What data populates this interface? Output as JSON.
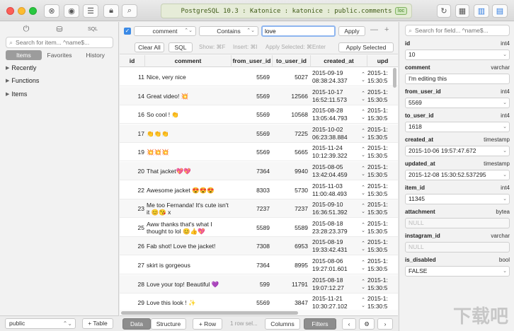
{
  "toolbar": {
    "connection": "PostgreSQL 10.3 : Katonice : katonice : public.comments",
    "loc_badge": "loc"
  },
  "sidebar": {
    "search_placeholder": "Search for item... ^name$...",
    "tabs": [
      "Items",
      "Favorites",
      "History"
    ],
    "tree": [
      "Recently",
      "Functions",
      "Items"
    ],
    "schema": "public",
    "add_table": "+ Table"
  },
  "filter": {
    "column": "comment",
    "operator": "Contains",
    "value": "love",
    "apply": "Apply",
    "clear_all": "Clear All",
    "sql": "SQL",
    "show_hint": "Show: ⌘F",
    "insert_hint": "Insert: ⌘I",
    "apply_selected_hint": "Apply Selected: ⌘Enter",
    "apply_selected": "Apply Selected"
  },
  "table": {
    "columns": [
      "id",
      "comment",
      "from_user_id",
      "to_user_id",
      "created_at",
      "upd"
    ],
    "rows": [
      {
        "id": "11",
        "comment": "Nice, very nice",
        "from": "5569",
        "to": "5027",
        "created": [
          "2015-09-19",
          "08:38:24.337"
        ],
        "upd": [
          "2015-1:",
          "15:30:5"
        ]
      },
      {
        "id": "14",
        "comment": "Great video! 💥",
        "from": "5569",
        "to": "12566",
        "created": [
          "2015-10-17",
          "16:52:11.573"
        ],
        "upd": [
          "2015-1:",
          "15:30:5"
        ]
      },
      {
        "id": "16",
        "comment": "So cool ! 👏",
        "from": "5569",
        "to": "10568",
        "created": [
          "2015-08-28",
          "13:05:44.793"
        ],
        "upd": [
          "2015-1:",
          "15:30:5"
        ]
      },
      {
        "id": "17",
        "comment": "👏👏👏",
        "from": "5569",
        "to": "7225",
        "created": [
          "2015-10-02",
          "06:23:38.884"
        ],
        "upd": [
          "2015-1:",
          "15:30:5"
        ]
      },
      {
        "id": "19",
        "comment": "💥💥💥",
        "from": "5569",
        "to": "5665",
        "created": [
          "2015-11-24",
          "10:12:39.322"
        ],
        "upd": [
          "2015-1:",
          "15:30:5"
        ]
      },
      {
        "id": "20",
        "comment": "That jacket💖💖",
        "from": "7364",
        "to": "9940",
        "created": [
          "2015-08-05",
          "13:42:04.459"
        ],
        "upd": [
          "2015-1:",
          "15:30:5"
        ]
      },
      {
        "id": "22",
        "comment": "Awesome jacket 😍😍😍",
        "from": "8303",
        "to": "5730",
        "created": [
          "2015-11-03",
          "11:00:48.493"
        ],
        "upd": [
          "2015-1:",
          "15:30:5"
        ]
      },
      {
        "id": "23",
        "comment": "Me too Fernanda! It's cute isn't it 😊😘 x",
        "from": "7237",
        "to": "7237",
        "created": [
          "2015-09-10",
          "16:36:51.392"
        ],
        "upd": [
          "2015-1:",
          "15:30:5"
        ]
      },
      {
        "id": "25",
        "comment": "Aww thanks that's what I thought to lol 😊👍💖",
        "from": "5589",
        "to": "5589",
        "created": [
          "2015-08-18",
          "23:28:23.379"
        ],
        "upd": [
          "2015-1:",
          "15:30:5"
        ]
      },
      {
        "id": "26",
        "comment": "Fab shot! Love the jacket!",
        "from": "7308",
        "to": "6953",
        "created": [
          "2015-08-19",
          "19:33:42.431"
        ],
        "upd": [
          "2015-1:",
          "15:30:5"
        ]
      },
      {
        "id": "27",
        "comment": "skirt is gorgeous",
        "from": "7364",
        "to": "8995",
        "created": [
          "2015-08-06",
          "19:27:01.601"
        ],
        "upd": [
          "2015-1:",
          "15:30:5"
        ]
      },
      {
        "id": "28",
        "comment": "Love your top! Beautiful 💜",
        "from": "599",
        "to": "11791",
        "created": [
          "2015-08-18",
          "19:07:12.27"
        ],
        "upd": [
          "2015-1:",
          "15:30:5"
        ]
      },
      {
        "id": "29",
        "comment": "Love this look ! ✨",
        "from": "5569",
        "to": "3847",
        "created": [
          "2015-11-21",
          "10:30:27.102"
        ],
        "upd": [
          "2015-1:",
          "15:30:5"
        ]
      }
    ]
  },
  "bottombar": {
    "data": "Data",
    "structure": "Structure",
    "add_row": "+ Row",
    "row_selected": "1 row sel...",
    "columns": "Columns",
    "filters": "Filters"
  },
  "right_pane": {
    "search_placeholder": "Search for field... ^name$...",
    "fields": [
      {
        "name": "id",
        "type": "int4",
        "value": "10",
        "null": false,
        "chevron": true
      },
      {
        "name": "comment",
        "type": "varchar",
        "value": "I'm editing this",
        "null": false,
        "chevron": false
      },
      {
        "name": "from_user_id",
        "type": "int4",
        "value": "5569",
        "null": false,
        "chevron": true
      },
      {
        "name": "to_user_id",
        "type": "int4",
        "value": "1618",
        "null": false,
        "chevron": true
      },
      {
        "name": "created_at",
        "type": "timestamp",
        "value": "2015-10-06 19:57:47.672",
        "null": false,
        "chevron": true
      },
      {
        "name": "updated_at",
        "type": "timestamp",
        "value": "2015-12-08 15:30:52.537295",
        "null": false,
        "chevron": true
      },
      {
        "name": "item_id",
        "type": "int4",
        "value": "11345",
        "null": false,
        "chevron": true
      },
      {
        "name": "attachment",
        "type": "bytea",
        "value": "NULL",
        "null": true,
        "chevron": false
      },
      {
        "name": "instagram_id",
        "type": "varchar",
        "value": "NULL",
        "null": true,
        "chevron": false
      },
      {
        "name": "is_disabled",
        "type": "bool",
        "value": "FALSE",
        "null": false,
        "chevron": true
      }
    ]
  },
  "colors": {
    "accent": "#3b8ae6",
    "connection_bg": "#e6ecd8",
    "connection_text": "#3f5a17"
  }
}
